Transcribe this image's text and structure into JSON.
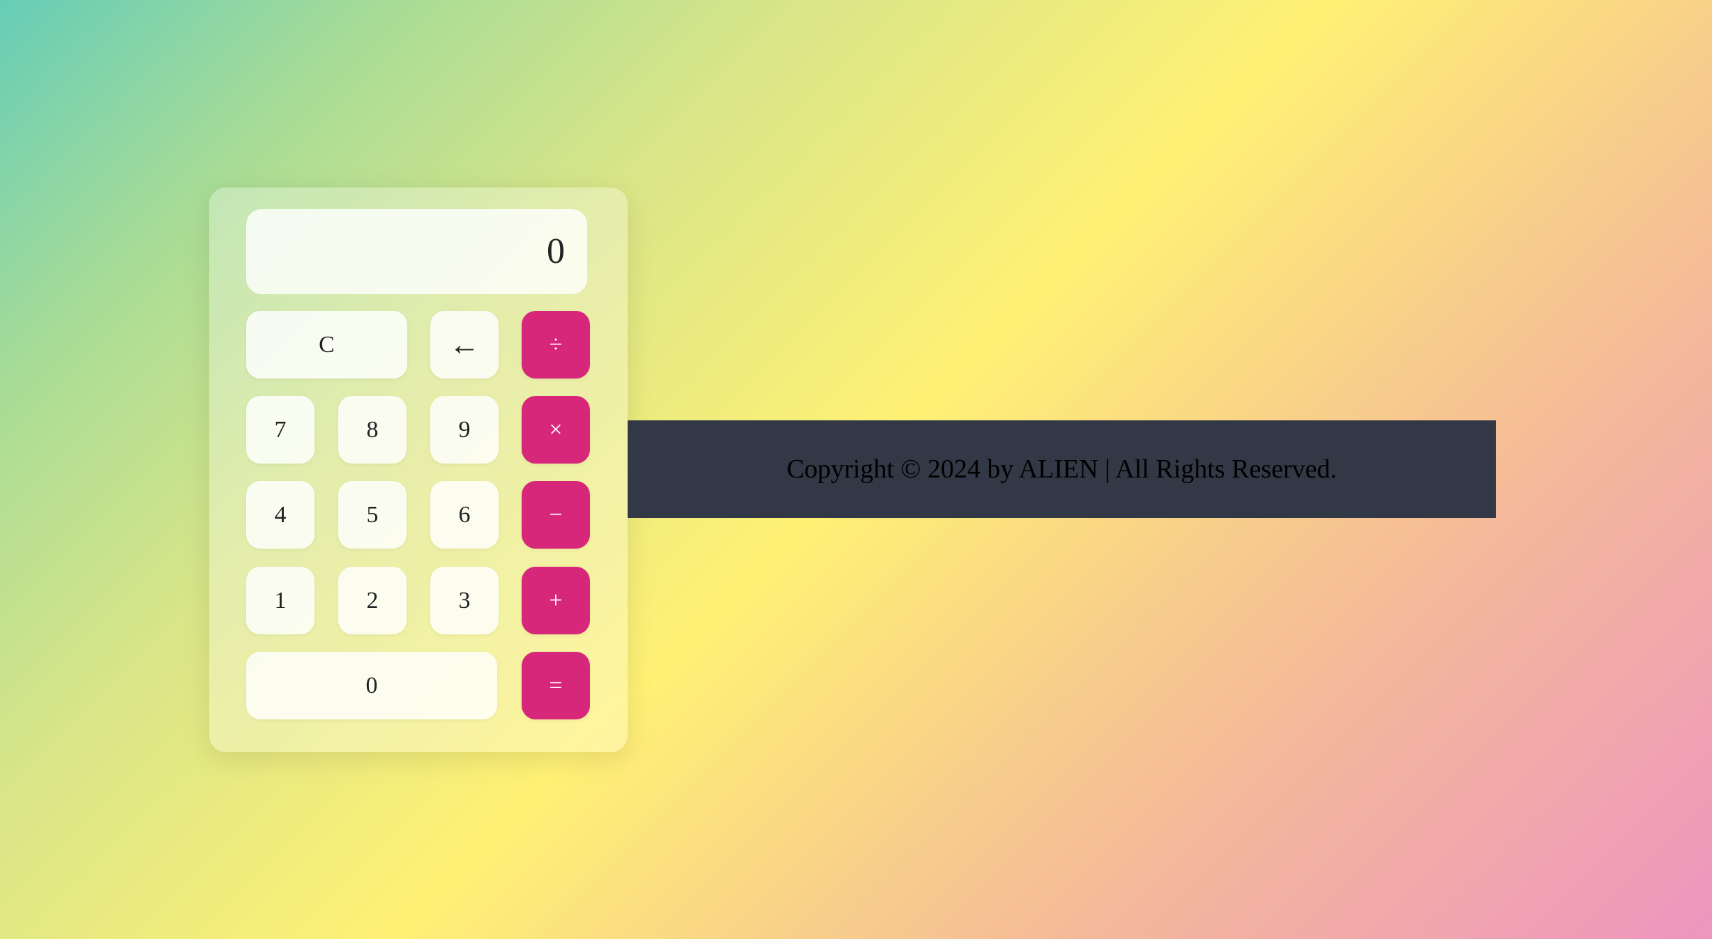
{
  "calculator": {
    "display": "0",
    "keys": {
      "clear": "C",
      "backspace": "←",
      "divide": "÷",
      "multiply": "×",
      "subtract": "−",
      "add": "+",
      "equals": "=",
      "seven": "7",
      "eight": "8",
      "nine": "9",
      "four": "4",
      "five": "5",
      "six": "6",
      "one": "1",
      "two": "2",
      "three": "3",
      "zero": "0"
    }
  },
  "footer": {
    "text": "Copyright © 2024 by ALIEN | All Rights Reserved."
  },
  "colors": {
    "operator": "#d6277a",
    "footer_bg": "#323845"
  }
}
